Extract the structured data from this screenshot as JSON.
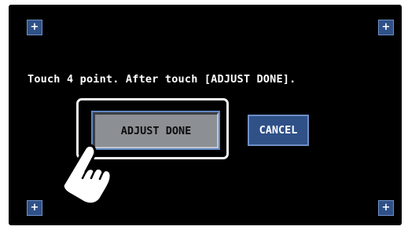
{
  "screen": {
    "instruction": "Touch 4 point. After touch [ADJUST DONE].",
    "corner_markers": {
      "top_left": "+",
      "top_right": "+",
      "bottom_left": "+",
      "bottom_right": "+"
    },
    "buttons": {
      "adjust_done": "ADJUST DONE",
      "cancel": "CANCEL"
    }
  },
  "icons": {
    "pointer": "pointing-hand-icon"
  },
  "colors": {
    "screen_background": "#000000",
    "button_blue": "#2f5188",
    "button_border": "#6d8fc6",
    "pressed_button_gray": "#8c8f93",
    "text": "#ffffff"
  }
}
